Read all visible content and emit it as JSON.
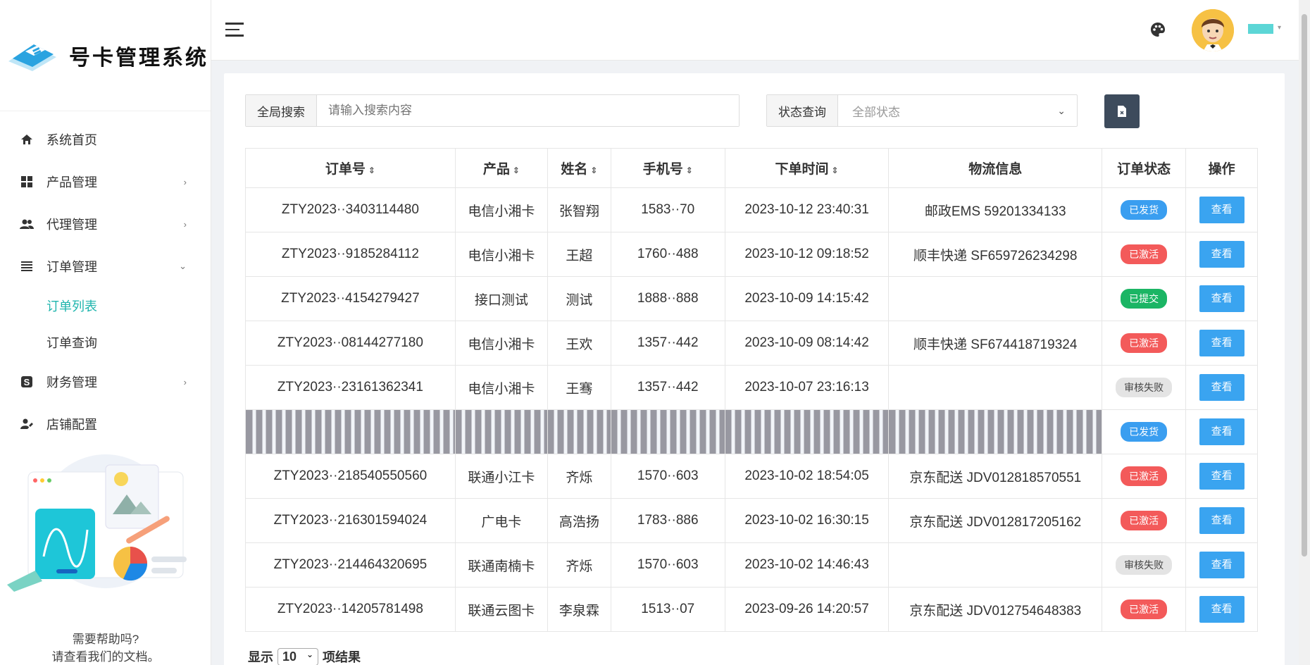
{
  "brand": {
    "title": "号卡管理系统"
  },
  "sidebar": {
    "items": [
      {
        "label": "系统首页",
        "icon": "home-icon",
        "has_children": false
      },
      {
        "label": "产品管理",
        "icon": "grid-icon",
        "has_children": true
      },
      {
        "label": "代理管理",
        "icon": "users-icon",
        "has_children": true
      },
      {
        "label": "订单管理",
        "icon": "list-icon",
        "has_children": true,
        "expanded": true
      },
      {
        "label": "财务管理",
        "icon": "dollar-icon",
        "has_children": true
      },
      {
        "label": "店铺配置",
        "icon": "user-settings-icon",
        "has_children": false
      }
    ],
    "sub_items": [
      {
        "label": "订单列表",
        "active": true
      },
      {
        "label": "订单查询",
        "active": false
      }
    ],
    "help_line1": "需要帮助吗?",
    "help_line2": "请查看我们的文档。"
  },
  "filters": {
    "search_label": "全局搜索",
    "search_placeholder": "请输入搜索内容",
    "status_label": "状态查询",
    "status_value": "全部状态"
  },
  "table": {
    "headers": [
      "订单号",
      "产品",
      "姓名",
      "手机号",
      "下单时间",
      "物流信息",
      "订单状态",
      "操作"
    ],
    "view_label": "查看",
    "rows": [
      {
        "order": "ZTY2023··3403114480",
        "product": "电信小湘卡",
        "name": "张智翔",
        "phone": "1583··70",
        "time": "2023-10-12 23:40:31",
        "logistics": "邮政EMS 59201334133",
        "status": "已发货",
        "status_type": "blue"
      },
      {
        "order": "ZTY2023··9185284112",
        "product": "电信小湘卡",
        "name": "王超",
        "phone": "1760··488",
        "time": "2023-10-12 09:18:52",
        "logistics": "顺丰快递 SF659726234298",
        "status": "已激活",
        "status_type": "red"
      },
      {
        "order": "ZTY2023··4154279427",
        "product": "接口测试",
        "name": "测试",
        "phone": "1888··888",
        "time": "2023-10-09 14:15:42",
        "logistics": "",
        "status": "已提交",
        "status_type": "green"
      },
      {
        "order": "ZTY2023··08144277180",
        "product": "电信小湘卡",
        "name": "王欢",
        "phone": "1357··442",
        "time": "2023-10-09 08:14:42",
        "logistics": "顺丰快递 SF674418719324",
        "status": "已激活",
        "status_type": "red"
      },
      {
        "order": "ZTY2023··23161362341",
        "product": "电信小湘卡",
        "name": "王骞",
        "phone": "1357··442",
        "time": "2023-10-07 23:16:13",
        "logistics": "",
        "status": "审核失败",
        "status_type": "gray"
      },
      {
        "order": "",
        "product": "",
        "name": "",
        "phone": "",
        "time": "",
        "logistics": "",
        "status": "已发货",
        "status_type": "blue",
        "masked": true
      },
      {
        "order": "ZTY2023··218540550560",
        "product": "联通小江卡",
        "name": "齐烁",
        "phone": "1570··603",
        "time": "2023-10-02 18:54:05",
        "logistics": "京东配送 JDV012818570551",
        "status": "已激活",
        "status_type": "red"
      },
      {
        "order": "ZTY2023··216301594024",
        "product": "广电卡",
        "name": "高浩扬",
        "phone": "1783··886",
        "time": "2023-10-02 16:30:15",
        "logistics": "京东配送 JDV012817205162",
        "status": "已激活",
        "status_type": "red"
      },
      {
        "order": "ZTY2023··214464320695",
        "product": "联通南楠卡",
        "name": "齐烁",
        "phone": "1570··603",
        "time": "2023-10-02 14:46:43",
        "logistics": "",
        "status": "审核失败",
        "status_type": "gray"
      },
      {
        "order": "ZTY2023··14205781498",
        "product": "联通云图卡",
        "name": "李泉霖",
        "phone": "1513··07",
        "time": "2023-09-26 14:20:57",
        "logistics": "京东配送 JDV012754648383",
        "status": "已激活",
        "status_type": "red"
      }
    ]
  },
  "pagination": {
    "show_label": "显示",
    "page_size": "10",
    "suffix_label": "项结果"
  },
  "colors": {
    "accent": "#1fb5ad",
    "view_button": "#3aa4f0",
    "export_button": "#3d4b5c"
  }
}
